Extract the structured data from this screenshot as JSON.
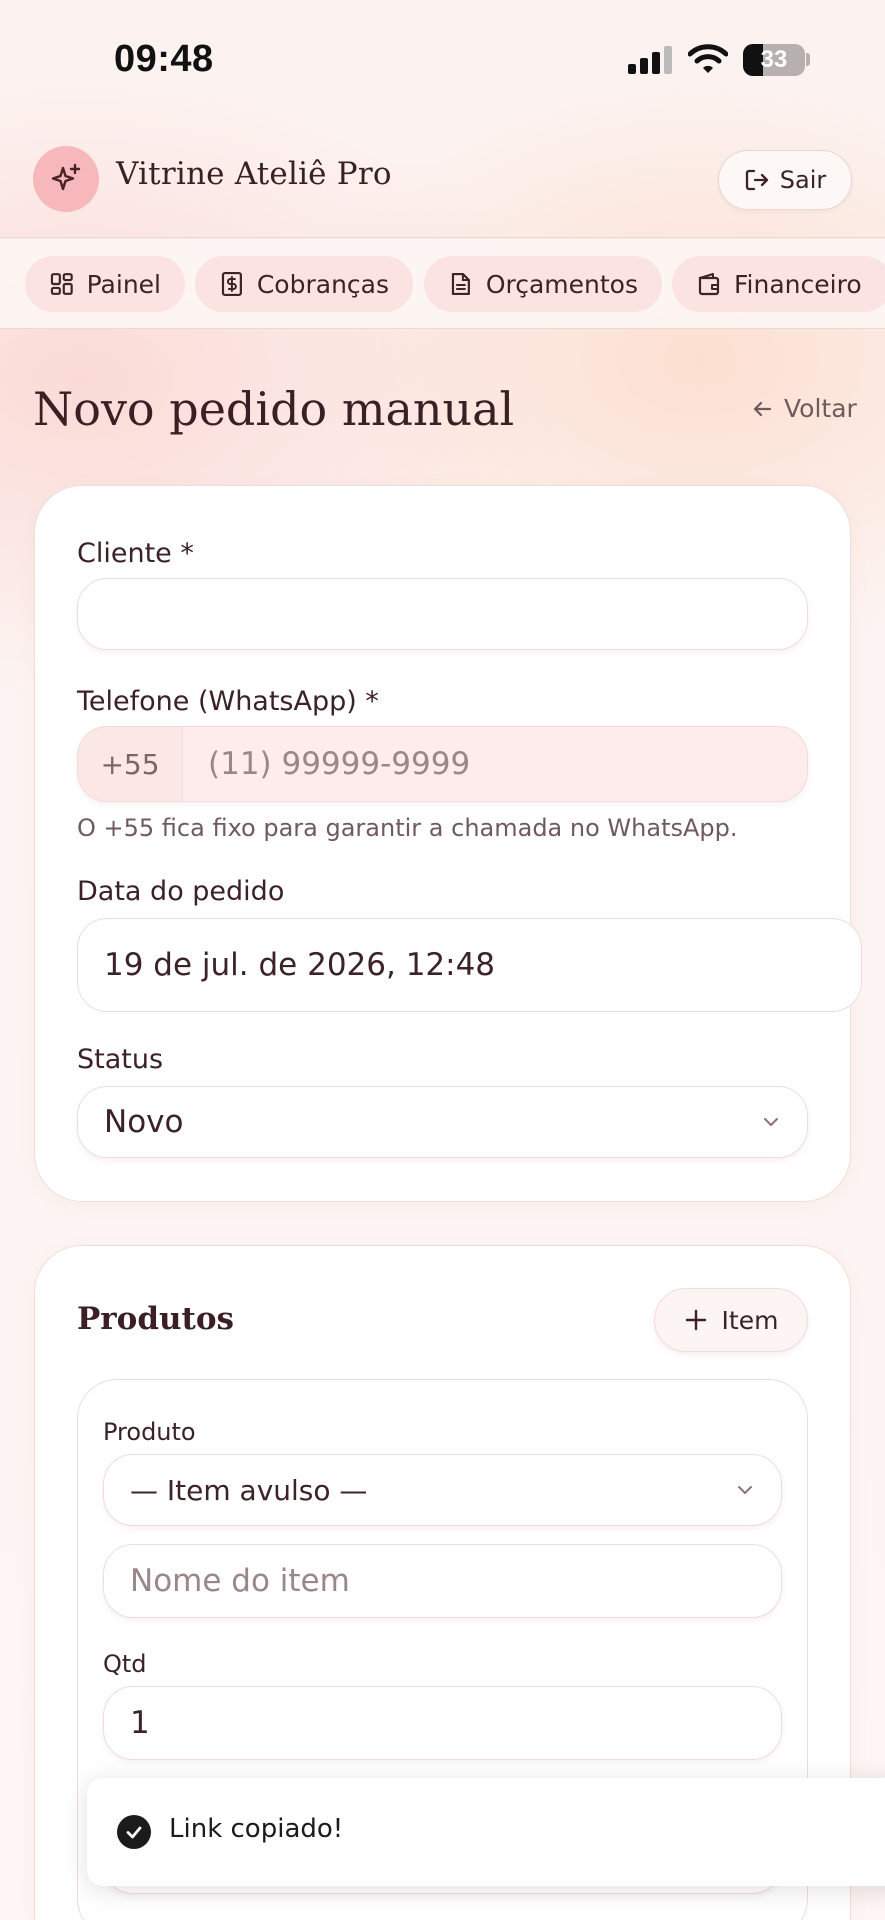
{
  "status_bar": {
    "time": "09:48",
    "battery": "33",
    "battery_level": 0.33
  },
  "header": {
    "brand": "Vitrine Ateliê Pro",
    "logout_label": "Sair"
  },
  "nav": {
    "tabs": [
      {
        "label": "Painel",
        "icon": "dashboard-icon"
      },
      {
        "label": "Cobranças",
        "icon": "receipt-dollar-icon"
      },
      {
        "label": "Orçamentos",
        "icon": "document-icon"
      },
      {
        "label": "Financeiro",
        "icon": "wallet-icon"
      }
    ]
  },
  "page": {
    "title": "Novo pedido manual",
    "back_label": "Voltar"
  },
  "form": {
    "client_label": "Cliente *",
    "client_value": "",
    "phone_label": "Telefone (WhatsApp) *",
    "phone_prefix": "+55",
    "phone_placeholder": "(11) 99999-9999",
    "phone_hint": "O +55 fica fixo para garantir a chamada no WhatsApp.",
    "date_label": "Data do pedido",
    "date_value": "19 de jul. de 2026, 12:48",
    "status_label": "Status",
    "status_value": "Novo"
  },
  "products": {
    "title": "Produtos",
    "add_item_label": "Item",
    "product_label": "Produto",
    "product_value": "— Item avulso —",
    "item_name_placeholder": "Nome do item",
    "qty_label": "Qtd",
    "qty_value": "1"
  },
  "toast": {
    "message": "Link copiado!"
  }
}
